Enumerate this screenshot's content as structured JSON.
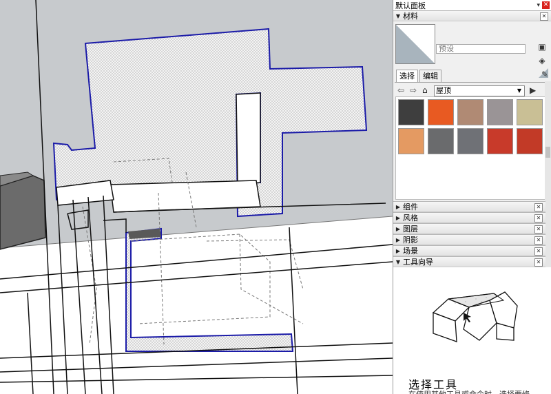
{
  "panel": {
    "title": "默认面板",
    "pin_icon": "pin-icon",
    "close_icon": "close-icon"
  },
  "materials": {
    "header": "材料",
    "name_placeholder": "预设",
    "tabs": [
      "选择",
      "编辑"
    ],
    "library": "屋顶",
    "swatch_colors": [
      "#3e3e3e",
      "#e85a22",
      "#b08a74",
      "#9a9496",
      "#c9bf95",
      "#e49a62",
      "#6a6b6d",
      "#6f7176",
      "#c83a2a",
      "#c23a27"
    ]
  },
  "sections": [
    {
      "label": "组件"
    },
    {
      "label": "风格"
    },
    {
      "label": "图层"
    },
    {
      "label": "阴影"
    },
    {
      "label": "场景"
    },
    {
      "label": "工具向导"
    }
  ],
  "guide": {
    "title": "选择工具",
    "text": "在使用其他工具或命令时，选择要修"
  },
  "colors": {
    "selection_edge": "#1b1ba8",
    "sky": "#c7cacd",
    "ground": "#ffffff"
  }
}
